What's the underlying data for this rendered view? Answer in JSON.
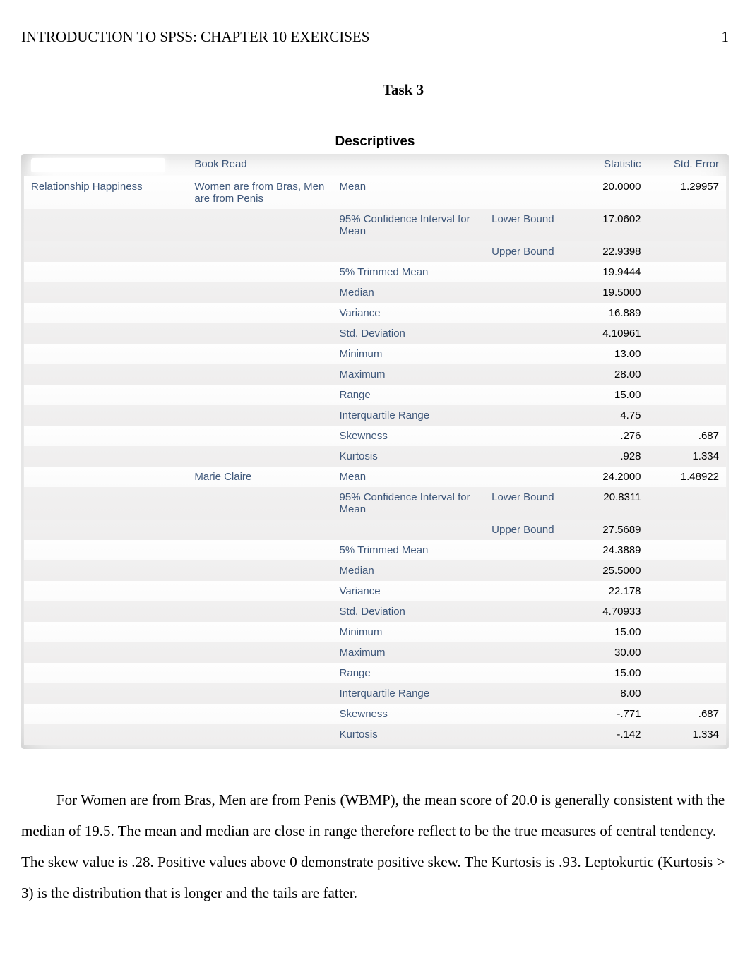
{
  "header": {
    "title": "INTRODUCTION TO SPSS: CHAPTER 10 EXERCISES",
    "page": "1"
  },
  "task_title": "Task 3",
  "table": {
    "title": "Descriptives",
    "headers": {
      "book": "Book Read",
      "stat": "Statistic",
      "stderr": "Std. Error"
    },
    "dv_label": "Relationship Happiness",
    "groups": [
      {
        "book": "Women are from Bras, Men are from Penis",
        "rows": [
          {
            "measure": "Mean",
            "bound": "",
            "stat": "20.0000",
            "stderr": "1.29957"
          },
          {
            "measure": "95% Confidence Interval for Mean",
            "bound": "Lower Bound",
            "stat": "17.0602",
            "stderr": ""
          },
          {
            "measure": "",
            "bound": "Upper Bound",
            "stat": "22.9398",
            "stderr": ""
          },
          {
            "measure": "5% Trimmed Mean",
            "bound": "",
            "stat": "19.9444",
            "stderr": ""
          },
          {
            "measure": "Median",
            "bound": "",
            "stat": "19.5000",
            "stderr": ""
          },
          {
            "measure": "Variance",
            "bound": "",
            "stat": "16.889",
            "stderr": ""
          },
          {
            "measure": "Std. Deviation",
            "bound": "",
            "stat": "4.10961",
            "stderr": ""
          },
          {
            "measure": "Minimum",
            "bound": "",
            "stat": "13.00",
            "stderr": ""
          },
          {
            "measure": "Maximum",
            "bound": "",
            "stat": "28.00",
            "stderr": ""
          },
          {
            "measure": "Range",
            "bound": "",
            "stat": "15.00",
            "stderr": ""
          },
          {
            "measure": "Interquartile Range",
            "bound": "",
            "stat": "4.75",
            "stderr": ""
          },
          {
            "measure": "Skewness",
            "bound": "",
            "stat": ".276",
            "stderr": ".687"
          },
          {
            "measure": "Kurtosis",
            "bound": "",
            "stat": ".928",
            "stderr": "1.334"
          }
        ]
      },
      {
        "book": "Marie Claire",
        "rows": [
          {
            "measure": "Mean",
            "bound": "",
            "stat": "24.2000",
            "stderr": "1.48922"
          },
          {
            "measure": "95% Confidence Interval for Mean",
            "bound": "Lower Bound",
            "stat": "20.8311",
            "stderr": ""
          },
          {
            "measure": "",
            "bound": "Upper Bound",
            "stat": "27.5689",
            "stderr": ""
          },
          {
            "measure": "5% Trimmed Mean",
            "bound": "",
            "stat": "24.3889",
            "stderr": ""
          },
          {
            "measure": "Median",
            "bound": "",
            "stat": "25.5000",
            "stderr": ""
          },
          {
            "measure": "Variance",
            "bound": "",
            "stat": "22.178",
            "stderr": ""
          },
          {
            "measure": "Std. Deviation",
            "bound": "",
            "stat": "4.70933",
            "stderr": ""
          },
          {
            "measure": "Minimum",
            "bound": "",
            "stat": "15.00",
            "stderr": ""
          },
          {
            "measure": "Maximum",
            "bound": "",
            "stat": "30.00",
            "stderr": ""
          },
          {
            "measure": "Range",
            "bound": "",
            "stat": "15.00",
            "stderr": ""
          },
          {
            "measure": "Interquartile Range",
            "bound": "",
            "stat": "8.00",
            "stderr": ""
          },
          {
            "measure": "Skewness",
            "bound": "",
            "stat": "-.771",
            "stderr": ".687"
          },
          {
            "measure": "Kurtosis",
            "bound": "",
            "stat": "-.142",
            "stderr": "1.334"
          }
        ]
      }
    ]
  },
  "paragraph": "For Women are from Bras, Men are from Penis (WBMP), the mean score of 20.0 is generally consistent with the median of 19.5. The mean and median are close in range therefore reflect to be the true measures of central tendency. The skew value is .28. Positive values above 0 demonstrate positive skew.  The Kurtosis is .93. Leptokurtic (Kurtosis > 3) is the distribution that is longer and the tails are fatter."
}
